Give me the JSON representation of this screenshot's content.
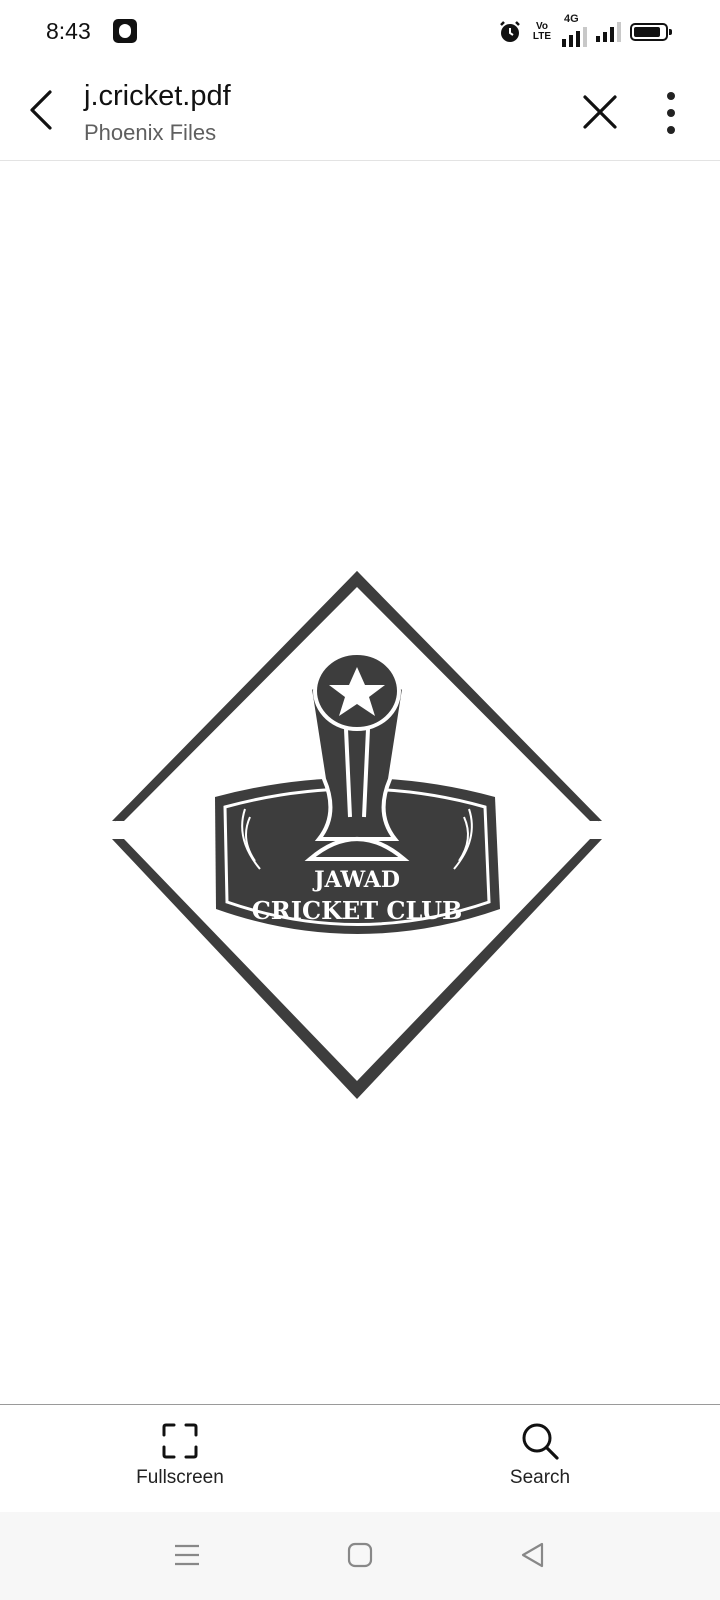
{
  "status_bar": {
    "time": "8:43",
    "volte_label": "Vo LTE",
    "network_label": "4G"
  },
  "header": {
    "title": "j.cricket.pdf",
    "subtitle": "Phoenix Files"
  },
  "document": {
    "logo_text_line1": "JAWAD",
    "logo_text_line2": "CRICKET CLUB",
    "logo_color": "#3d3d3d"
  },
  "toolbar": {
    "fullscreen_label": "Fullscreen",
    "search_label": "Search"
  },
  "icons": {
    "back": "chevron-left-icon",
    "close": "close-icon",
    "more": "more-vertical-icon",
    "fullscreen": "fullscreen-icon",
    "search": "search-icon",
    "nav_menu": "menu-icon",
    "nav_home": "home-icon",
    "nav_back": "back-triangle-icon"
  }
}
